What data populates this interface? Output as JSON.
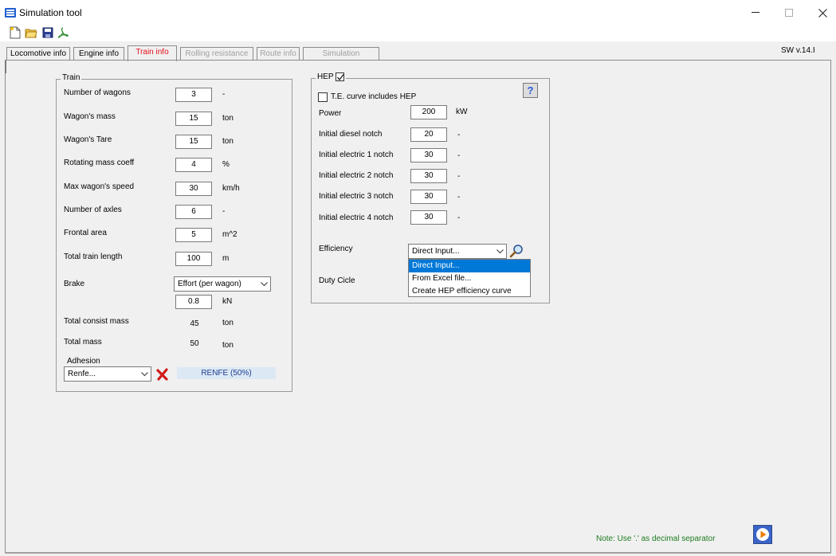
{
  "window": {
    "title": "Simulation tool",
    "minimize_glyph": "—",
    "maximize_glyph": "☐",
    "close_glyph": "✕"
  },
  "toolbar": {
    "icons": [
      "new-file-icon",
      "open-folder-icon",
      "save-disk-icon",
      "acrobat-pdf-icon"
    ]
  },
  "tabs": [
    {
      "label": "Locomotive info",
      "state": "normal"
    },
    {
      "label": "Engine info",
      "state": "normal"
    },
    {
      "label": "Train info",
      "state": "active"
    },
    {
      "label": "Rolling resistance",
      "state": "disabled"
    },
    {
      "label": "Route info",
      "state": "disabled"
    },
    {
      "label": "Simulation",
      "state": "disabled"
    }
  ],
  "sw_version": "SW v.14.I",
  "train": {
    "legend": "Train",
    "rows": [
      {
        "label": "Number of wagons",
        "value": "3",
        "unit": "-"
      },
      {
        "label": "Wagon's mass",
        "value": "15",
        "unit": "ton"
      },
      {
        "label": "Wagon's Tare",
        "value": "15",
        "unit": "ton"
      },
      {
        "label": "Rotating mass coeff",
        "value": "4",
        "unit": "%"
      },
      {
        "label": "Max wagon's speed",
        "value": "30",
        "unit": "km/h"
      },
      {
        "label": "Number of axles",
        "value": "6",
        "unit": "-"
      },
      {
        "label": "Frontal area",
        "value": "5",
        "unit": "m^2"
      },
      {
        "label": "Total train length",
        "value": "100",
        "unit": "m"
      }
    ],
    "brake_label": "Brake",
    "brake_mode": "Effort (per wagon)",
    "brake_value": "0.8",
    "brake_unit": "kN",
    "total_consist_mass_label": "Total consist mass",
    "total_consist_mass_value": "45",
    "total_consist_mass_unit": "ton",
    "total_mass_label": "Total mass",
    "total_mass_value": "50",
    "total_mass_unit": "ton",
    "adhesion_label": "Adhesion",
    "adhesion_value": "Renfe...",
    "adhesion_status": "RENFE  (50%)"
  },
  "hep": {
    "legend": "HEP",
    "enabled": true,
    "te_curve_label": "T.E. curve includes HEP",
    "te_curve_checked": false,
    "help_label": "?",
    "rows": [
      {
        "label": "Power",
        "value": "200",
        "unit": "kW"
      },
      {
        "label": "Initial diesel notch",
        "value": "20",
        "unit": "-"
      },
      {
        "label": "Initial electric 1 notch",
        "value": "30",
        "unit": "-"
      },
      {
        "label": "Initial electric 2 notch",
        "value": "30",
        "unit": "-"
      },
      {
        "label": "Initial electric 3 notch",
        "value": "30",
        "unit": "-"
      },
      {
        "label": "Initial electric 4 notch",
        "value": "30",
        "unit": "-"
      }
    ],
    "efficiency_label": "Efficiency",
    "efficiency_value": "Direct Input...",
    "efficiency_options": [
      "Direct Input...",
      "From Excel file...",
      "Create HEP efficiency curve"
    ],
    "efficiency_selected_index": 0,
    "duty_cycle_label": "Duty Cicle"
  },
  "footer": {
    "note": "Note: Use '.' as decimal separator"
  },
  "colors": {
    "active_tab": "#e3101c",
    "note": "#1e7b1e",
    "selection": "#0078d7",
    "app_icon": "#1f5fd0"
  }
}
